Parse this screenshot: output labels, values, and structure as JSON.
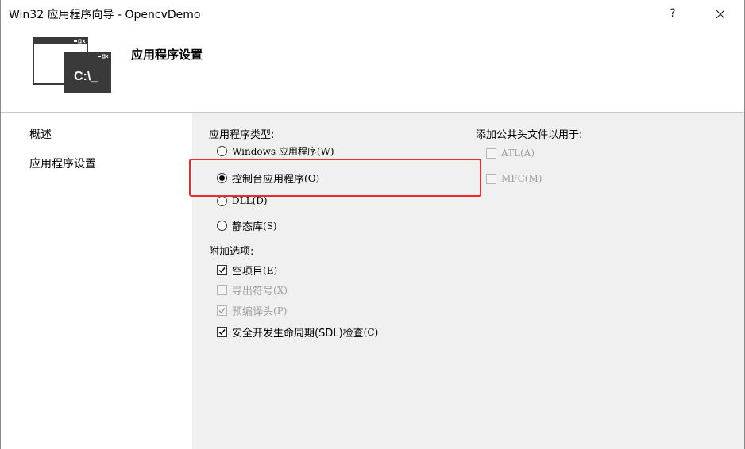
{
  "window": {
    "title": "Win32 应用程序向导 - OpencvDemo",
    "help_label": "?"
  },
  "header": {
    "title": "应用程序设置",
    "icon_text": "C:\\_"
  },
  "sidebar": {
    "items": [
      {
        "label": "概述"
      },
      {
        "label": "应用程序设置"
      }
    ]
  },
  "app_type": {
    "label": "应用程序类型:",
    "options": [
      {
        "label": "Windows 应用程序",
        "mnemonic": "(W)",
        "selected": false
      },
      {
        "label": "控制台应用程序",
        "mnemonic": "(O)",
        "selected": true
      },
      {
        "label": "DLL",
        "mnemonic": "(D)",
        "selected": false
      },
      {
        "label": "静态库",
        "mnemonic": "(S)",
        "selected": false
      }
    ]
  },
  "extra_options": {
    "label": "附加选项:",
    "options": [
      {
        "label": "空项目",
        "mnemonic": "(E)",
        "checked": true,
        "enabled": true
      },
      {
        "label": "导出符号",
        "mnemonic": "(X)",
        "checked": false,
        "enabled": false
      },
      {
        "label": "预编译头",
        "mnemonic": "(P)",
        "checked": true,
        "enabled": false
      },
      {
        "label": "安全开发生命周期(SDL)检查",
        "mnemonic": "(C)",
        "checked": true,
        "enabled": true
      }
    ]
  },
  "common_headers": {
    "label": "添加公共头文件以用于:",
    "options": [
      {
        "label": "ATL",
        "mnemonic": "(A)",
        "checked": false,
        "enabled": false
      },
      {
        "label": "MFC",
        "mnemonic": "(M)",
        "checked": false,
        "enabled": false
      }
    ]
  },
  "colors": {
    "highlight": "#e82c2c",
    "panel": "#f0f0f0"
  }
}
